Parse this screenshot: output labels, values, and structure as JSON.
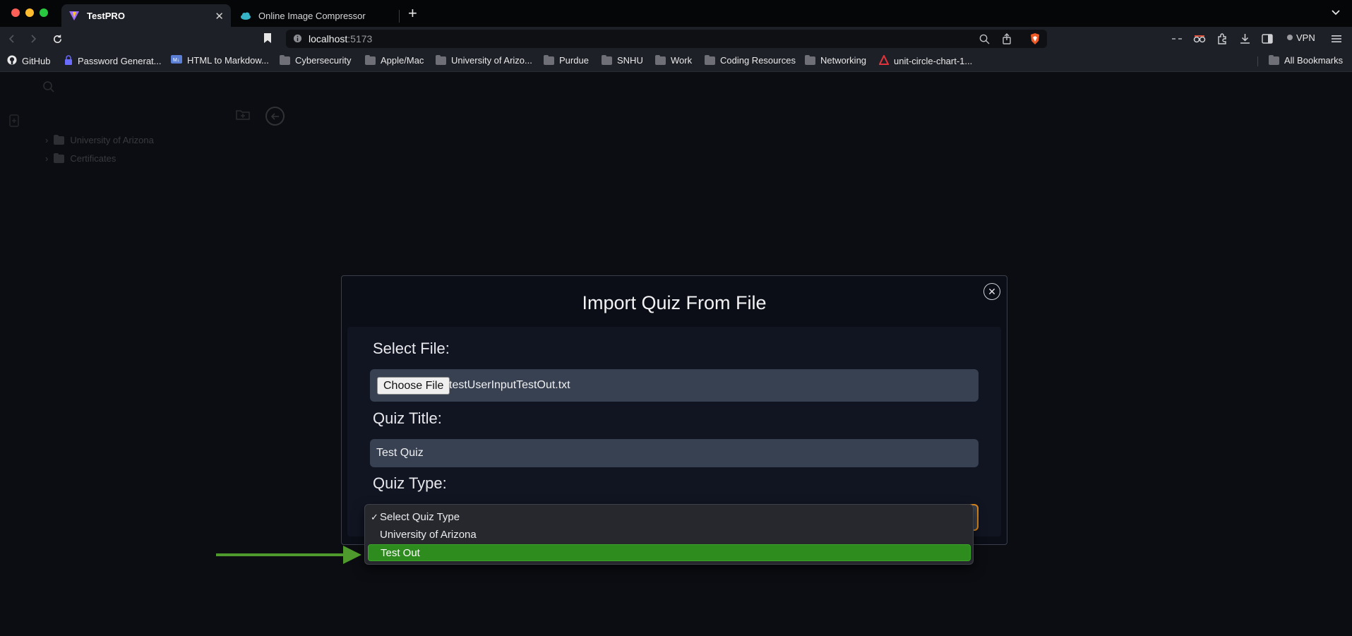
{
  "browser": {
    "tabs": [
      {
        "title": "TestPRO",
        "active": true
      },
      {
        "title": "Online Image Compressor",
        "active": false
      }
    ],
    "url": {
      "host": "localhost",
      "port": ":5173"
    },
    "vpn_label": "VPN",
    "bookmarks": [
      {
        "label": "GitHub",
        "icon": "github-icon"
      },
      {
        "label": "Password Generat...",
        "icon": "lock-icon"
      },
      {
        "label": "HTML to Markdow...",
        "icon": "markdown-icon"
      },
      {
        "label": "Cybersecurity",
        "icon": "folder-icon"
      },
      {
        "label": "Apple/Mac",
        "icon": "folder-icon"
      },
      {
        "label": "University of Arizo...",
        "icon": "folder-icon"
      },
      {
        "label": "Purdue",
        "icon": "folder-icon"
      },
      {
        "label": "SNHU",
        "icon": "folder-icon"
      },
      {
        "label": "Work",
        "icon": "folder-icon"
      },
      {
        "label": "Coding Resources",
        "icon": "folder-icon"
      },
      {
        "label": "Networking",
        "icon": "folder-icon"
      },
      {
        "label": "unit-circle-chart-1...",
        "icon": "pdf-icon"
      }
    ],
    "all_bookmarks_label": "All Bookmarks"
  },
  "app": {
    "tree": [
      {
        "label": "University of Arizona"
      },
      {
        "label": "Certificates"
      }
    ]
  },
  "modal": {
    "title": "Import Quiz From File",
    "file_label": "Select File:",
    "choose_file_button": "Choose File",
    "file_name": "testUserInputTestOut.txt",
    "quiz_title_label": "Quiz Title:",
    "quiz_title_value": "Test Quiz",
    "quiz_type_label": "Quiz Type:",
    "quiz_type_options": [
      {
        "label": "Select Quiz Type",
        "checked": true
      },
      {
        "label": "University of Arizona",
        "checked": false
      },
      {
        "label": "Test Out",
        "checked": false,
        "highlighted": true
      }
    ],
    "check_mark": "✓"
  },
  "colors": {
    "highlight": "#2e8b1e",
    "annotation_arrow": "#4f9a2c",
    "focus_border": "#e08a1a"
  }
}
